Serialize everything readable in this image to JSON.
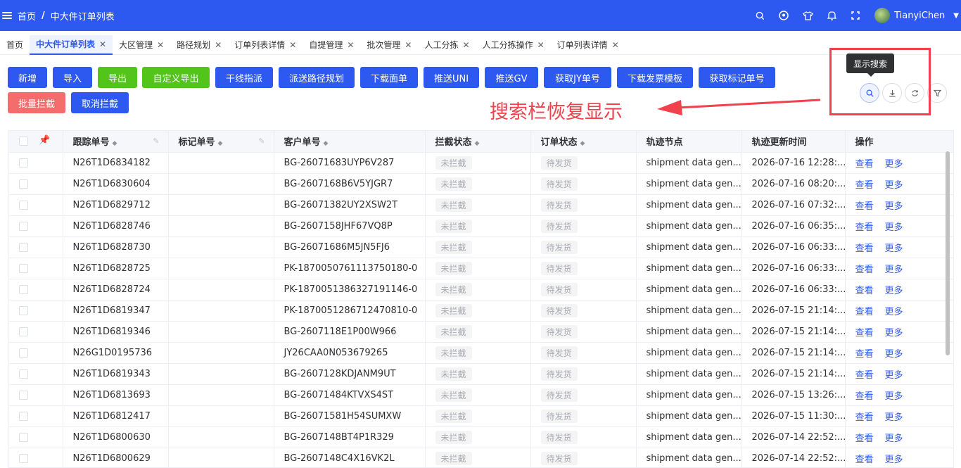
{
  "header": {
    "breadcrumb_home": "首页",
    "breadcrumb_sep": "/",
    "breadcrumb_current": "中大件订单列表",
    "username": "TianyiChen"
  },
  "tabs": [
    {
      "label": "首页",
      "closable": false,
      "active": false
    },
    {
      "label": "中大件订单列表",
      "closable": true,
      "active": true
    },
    {
      "label": "大区管理",
      "closable": true,
      "active": false
    },
    {
      "label": "路径规划",
      "closable": true,
      "active": false
    },
    {
      "label": "订单列表详情",
      "closable": true,
      "active": false
    },
    {
      "label": "自提管理",
      "closable": true,
      "active": false
    },
    {
      "label": "批次管理",
      "closable": true,
      "active": false
    },
    {
      "label": "人工分拣",
      "closable": true,
      "active": false
    },
    {
      "label": "人工分拣操作",
      "closable": true,
      "active": false
    },
    {
      "label": "订单列表详情",
      "closable": true,
      "active": false
    }
  ],
  "toolbar": {
    "add": "新增",
    "import": "导入",
    "export": "导出",
    "custom_export": "自定义导出",
    "trunk_dispatch": "干线指派",
    "delivery_route": "派送路径规划",
    "download_waybill": "下载面单",
    "push_uni": "推送UNI",
    "push_gv": "推送GV",
    "get_jy": "获取JY单号",
    "download_invoice": "下载发票模板",
    "get_mark": "获取标记单号",
    "batch_intercept": "批量拦截",
    "cancel_intercept": "取消拦截"
  },
  "right_tools": {
    "tooltip": "显示搜索",
    "icons": [
      "search-icon",
      "download-icon",
      "refresh-icon",
      "filter-icon"
    ]
  },
  "annotation": {
    "text": "搜索栏恢复显示"
  },
  "table": {
    "headers": {
      "tracking": "跟踪单号",
      "mark": "标记单号",
      "customer": "客户单号",
      "intercept_status": "拦截状态",
      "order_status": "订单状态",
      "track_node": "轨迹节点",
      "track_time": "轨迹更新时间",
      "ops": "操作"
    },
    "view_label": "查看",
    "more_label": "更多",
    "rows": [
      {
        "tracking": "N26T1D6834182",
        "mark": "",
        "customer": "BG-26071683UYP6V287",
        "intercept": "未拦截",
        "status": "待发货",
        "node": "shipment data gen...",
        "time": "2026-07-16 12:28:..."
      },
      {
        "tracking": "N26T1D6830604",
        "mark": "",
        "customer": "BG-2607168B6V5YJGR7",
        "intercept": "未拦截",
        "status": "待发货",
        "node": "shipment data gen...",
        "time": "2026-07-16 08:20:..."
      },
      {
        "tracking": "N26T1D6829712",
        "mark": "",
        "customer": "BG-26071382UY2XSW2T",
        "intercept": "未拦截",
        "status": "待发货",
        "node": "shipment data gen...",
        "time": "2026-07-16 07:32:..."
      },
      {
        "tracking": "N26T1D6828746",
        "mark": "",
        "customer": "BG-2607158JHF67VQ8P",
        "intercept": "未拦截",
        "status": "待发货",
        "node": "shipment data gen...",
        "time": "2026-07-16 06:35:..."
      },
      {
        "tracking": "N26T1D6828730",
        "mark": "",
        "customer": "BG-26071686M5JN5FJ6",
        "intercept": "未拦截",
        "status": "待发货",
        "node": "shipment data gen...",
        "time": "2026-07-16 06:33:..."
      },
      {
        "tracking": "N26T1D6828725",
        "mark": "",
        "customer": "PK-1870050761113750180-0",
        "intercept": "未拦截",
        "status": "待发货",
        "node": "shipment data gen...",
        "time": "2026-07-16 06:33:..."
      },
      {
        "tracking": "N26T1D6828724",
        "mark": "",
        "customer": "PK-1870051386327191146-0",
        "intercept": "未拦截",
        "status": "待发货",
        "node": "shipment data gen...",
        "time": "2026-07-16 06:33:..."
      },
      {
        "tracking": "N26T1D6819347",
        "mark": "",
        "customer": "PK-1870051286712470810-0",
        "intercept": "未拦截",
        "status": "待发货",
        "node": "shipment data gen...",
        "time": "2026-07-15 21:14:..."
      },
      {
        "tracking": "N26T1D6819346",
        "mark": "",
        "customer": "BG-2607118E1P00W966",
        "intercept": "未拦截",
        "status": "待发货",
        "node": "shipment data gen...",
        "time": "2026-07-15 21:14:..."
      },
      {
        "tracking": "N26G1D0195736",
        "mark": "",
        "customer": "JY26CAA0N053679265",
        "intercept": "未拦截",
        "status": "待发货",
        "node": "shipment data gen...",
        "time": "2026-07-15 21:14:..."
      },
      {
        "tracking": "N26T1D6819343",
        "mark": "",
        "customer": "BG-2607128KDJANM9UT",
        "intercept": "未拦截",
        "status": "待发货",
        "node": "shipment data gen...",
        "time": "2026-07-15 21:14:..."
      },
      {
        "tracking": "N26T1D6813693",
        "mark": "",
        "customer": "BG-26071484KTVXS4ST",
        "intercept": "未拦截",
        "status": "待发货",
        "node": "shipment data gen...",
        "time": "2026-07-15 13:26:..."
      },
      {
        "tracking": "N26T1D6812417",
        "mark": "",
        "customer": "BG-26071581H54SUMXW",
        "intercept": "未拦截",
        "status": "待发货",
        "node": "shipment data gen...",
        "time": "2026-07-15 11:30:..."
      },
      {
        "tracking": "N26T1D6800630",
        "mark": "",
        "customer": "BG-2607148BT4P1R329",
        "intercept": "未拦截",
        "status": "待发货",
        "node": "shipment data gen...",
        "time": "2026-07-14 22:52:..."
      },
      {
        "tracking": "N26T1D6800629",
        "mark": "",
        "customer": "BG-2607148C4X16VK2L",
        "intercept": "未拦截",
        "status": "待发货",
        "node": "shipment data gen...",
        "time": "2026-07-14 22:52:..."
      }
    ]
  },
  "colors": {
    "primary": "#2e59f0",
    "success": "#52c41a",
    "danger": "#f56c6c",
    "annotation": "#f0414c"
  }
}
